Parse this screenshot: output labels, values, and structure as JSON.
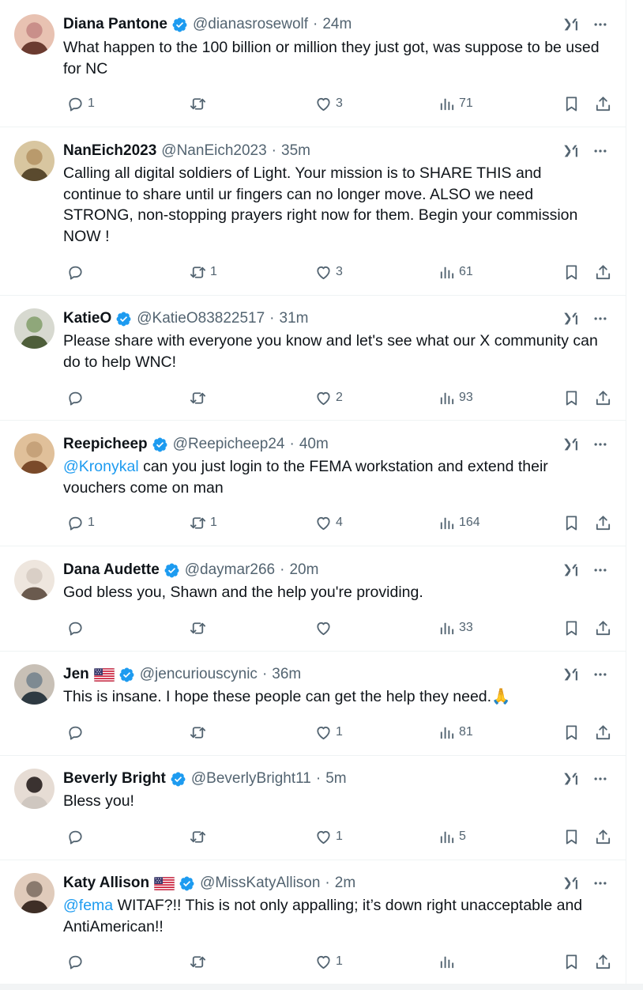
{
  "colors": {
    "text": "#0f1419",
    "secondary": "#536471",
    "accent": "#1d9bf0",
    "border": "#eff3f4"
  },
  "icons": {
    "reply": "reply-icon",
    "retweet": "retweet-icon",
    "like": "heart-icon",
    "views": "views-icon",
    "bookmark": "bookmark-icon",
    "share": "share-icon",
    "grok": "grok-icon",
    "more": "more-icon",
    "verified": "verified-badge-icon"
  },
  "tweets": [
    {
      "name": "Diana Pantone",
      "verified": true,
      "flag": false,
      "handle": "@dianasrosewolf",
      "time": "24m",
      "segments": [
        {
          "text": "What happen to the 100 billion or million they just got, was suppose to be used for NC",
          "mention": false
        }
      ],
      "replies": "1",
      "retweets": "",
      "likes": "3",
      "views": "71"
    },
    {
      "name": "NanEich2023",
      "verified": false,
      "flag": false,
      "handle": "@NanEich2023",
      "time": "35m",
      "segments": [
        {
          "text": "Calling all digital soldiers of Light. Your mission is to SHARE THIS and continue to share until ur fingers can no longer move. ALSO we need STRONG, non-stopping prayers right now for them. Begin your commission NOW !",
          "mention": false
        }
      ],
      "replies": "",
      "retweets": "1",
      "likes": "3",
      "views": "61"
    },
    {
      "name": "KatieO",
      "verified": true,
      "flag": false,
      "handle": "@KatieO83822517",
      "time": "31m",
      "segments": [
        {
          "text": "Please share with everyone you know and let's see what our X community can do to help WNC!",
          "mention": false
        }
      ],
      "replies": "",
      "retweets": "",
      "likes": "2",
      "views": "93"
    },
    {
      "name": "Reepicheep",
      "verified": true,
      "flag": false,
      "handle": "@Reepicheep24",
      "time": "40m",
      "segments": [
        {
          "text": "@Kronykal",
          "mention": true
        },
        {
          "text": " can you just login to the FEMA workstation and extend their vouchers come on man",
          "mention": false
        }
      ],
      "replies": "1",
      "retweets": "1",
      "likes": "4",
      "views": "164"
    },
    {
      "name": "Dana Audette",
      "verified": true,
      "flag": false,
      "handle": "@daymar266",
      "time": "20m",
      "segments": [
        {
          "text": "God bless you, Shawn and the help you're providing.",
          "mention": false
        }
      ],
      "replies": "",
      "retweets": "",
      "likes": "",
      "views": "33"
    },
    {
      "name": "Jen",
      "verified": true,
      "flag": true,
      "handle": "@jencuriouscynic",
      "time": "36m",
      "segments": [
        {
          "text": "This is insane. I hope these people can get the help they need.🙏",
          "mention": false
        }
      ],
      "replies": "",
      "retweets": "",
      "likes": "1",
      "views": "81"
    },
    {
      "name": "Beverly Bright",
      "verified": true,
      "flag": false,
      "handle": "@BeverlyBright11",
      "time": "5m",
      "segments": [
        {
          "text": "Bless you!",
          "mention": false
        }
      ],
      "replies": "",
      "retweets": "",
      "likes": "1",
      "views": "5"
    },
    {
      "name": "Katy Allison",
      "verified": true,
      "flag": true,
      "handle": "@MissKatyAllison",
      "time": "2m",
      "segments": [
        {
          "text": "@fema",
          "mention": true
        },
        {
          "text": " WITAF?!! This is not only appalling; it’s down right unacceptable and AntiAmerican!!",
          "mention": false
        }
      ],
      "replies": "",
      "retweets": "",
      "likes": "1",
      "views": ""
    }
  ]
}
